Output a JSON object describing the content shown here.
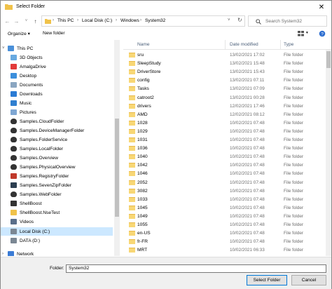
{
  "window": {
    "title": "Select Folder",
    "close_glyph": "✕"
  },
  "address": {
    "segments": [
      "This PC",
      "Local Disk (C:)",
      "Windows",
      "System32"
    ],
    "search_placeholder": "Search System32"
  },
  "commands": {
    "organize": "Organize ▾",
    "new_folder": "New folder"
  },
  "columns": {
    "name": "Name",
    "date": "Date modified",
    "type": "Type"
  },
  "sidebar": {
    "items": [
      {
        "label": "This PC",
        "icon": "pc-icon",
        "color": "#4a90d9"
      },
      {
        "label": "3D Objects",
        "icon": "3d-objects-icon",
        "color": "#68a9e0"
      },
      {
        "label": "AmalgaDrive",
        "icon": "amalgadrive-icon",
        "color": "#e23a3a"
      },
      {
        "label": "Desktop",
        "icon": "desktop-icon",
        "color": "#3c8fdc"
      },
      {
        "label": "Documents",
        "icon": "documents-icon",
        "color": "#8aa6c1"
      },
      {
        "label": "Downloads",
        "icon": "downloads-icon",
        "color": "#2a7bd4"
      },
      {
        "label": "Music",
        "icon": "music-icon",
        "color": "#2f7fd0"
      },
      {
        "label": "Pictures",
        "icon": "pictures-icon",
        "color": "#7fa7d3"
      },
      {
        "label": "Samples.CloudFolder",
        "icon": "penguin-icon",
        "color": "#333333"
      },
      {
        "label": "Samples.DeviceManagerFolder",
        "icon": "penguin-icon",
        "color": "#333333"
      },
      {
        "label": "Samples.FolderService",
        "icon": "penguin-icon",
        "color": "#333333"
      },
      {
        "label": "Samples.LocalFolder",
        "icon": "penguin-icon",
        "color": "#333333"
      },
      {
        "label": "Samples.Overview",
        "icon": "penguin-icon",
        "color": "#333333"
      },
      {
        "label": "Samples.PhysicalOverview",
        "icon": "penguin-icon",
        "color": "#333333"
      },
      {
        "label": "Samples.RegistryFolder",
        "icon": "registry-icon",
        "color": "#c0392b"
      },
      {
        "label": "Samples.SevenZipFolder",
        "icon": "zip-icon",
        "color": "#2c3e50"
      },
      {
        "label": "Samples.WebFolder",
        "icon": "penguin-icon",
        "color": "#333333"
      },
      {
        "label": "ShellBoost",
        "icon": "shellboost-icon",
        "color": "#333333"
      },
      {
        "label": "ShellBoost.NseTest",
        "icon": "folder-icon",
        "color": "#f0c24a"
      },
      {
        "label": "Videos",
        "icon": "videos-icon",
        "color": "#5a6f8a"
      },
      {
        "label": "Local Disk (C:)",
        "icon": "drive-icon",
        "color": "#7b8794"
      },
      {
        "label": "DATA (D:)",
        "icon": "drive-icon",
        "color": "#7b8794"
      },
      {
        "label": "Network",
        "icon": "network-icon",
        "color": "#3a7bd5"
      }
    ]
  },
  "files": [
    {
      "name": "sru",
      "date": "13/02/2021 17:02",
      "type": "File folder"
    },
    {
      "name": "SleepStudy",
      "date": "13/02/2021 15:48",
      "type": "File folder"
    },
    {
      "name": "DriverStore",
      "date": "13/02/2021 15:43",
      "type": "File folder"
    },
    {
      "name": "config",
      "date": "13/02/2021 07:11",
      "type": "File folder"
    },
    {
      "name": "Tasks",
      "date": "13/02/2021 07:09",
      "type": "File folder"
    },
    {
      "name": "catroot2",
      "date": "13/02/2021 00:28",
      "type": "File folder"
    },
    {
      "name": "drivers",
      "date": "12/02/2021 17:46",
      "type": "File folder"
    },
    {
      "name": "AMD",
      "date": "12/02/2021 08:12",
      "type": "File folder"
    },
    {
      "name": "1028",
      "date": "10/02/2021 07:48",
      "type": "File folder"
    },
    {
      "name": "1029",
      "date": "10/02/2021 07:48",
      "type": "File folder"
    },
    {
      "name": "1031",
      "date": "10/02/2021 07:48",
      "type": "File folder"
    },
    {
      "name": "1036",
      "date": "10/02/2021 07:48",
      "type": "File folder"
    },
    {
      "name": "1040",
      "date": "10/02/2021 07:48",
      "type": "File folder"
    },
    {
      "name": "1042",
      "date": "10/02/2021 07:48",
      "type": "File folder"
    },
    {
      "name": "1046",
      "date": "10/02/2021 07:48",
      "type": "File folder"
    },
    {
      "name": "2052",
      "date": "10/02/2021 07:48",
      "type": "File folder"
    },
    {
      "name": "3082",
      "date": "10/02/2021 07:48",
      "type": "File folder"
    },
    {
      "name": "1033",
      "date": "10/02/2021 07:48",
      "type": "File folder"
    },
    {
      "name": "1045",
      "date": "10/02/2021 07:48",
      "type": "File folder"
    },
    {
      "name": "1049",
      "date": "10/02/2021 07:48",
      "type": "File folder"
    },
    {
      "name": "1055",
      "date": "10/02/2021 07:48",
      "type": "File folder"
    },
    {
      "name": "en-US",
      "date": "10/02/2021 07:48",
      "type": "File folder"
    },
    {
      "name": "fr-FR",
      "date": "10/02/2021 07:48",
      "type": "File folder"
    },
    {
      "name": "MRT",
      "date": "10/02/2021 06:33",
      "type": "File folder"
    }
  ],
  "bottom": {
    "folder_label": "Folder:",
    "folder_value": "System32",
    "select_button": "Select Folder",
    "cancel_button": "Cancel"
  }
}
